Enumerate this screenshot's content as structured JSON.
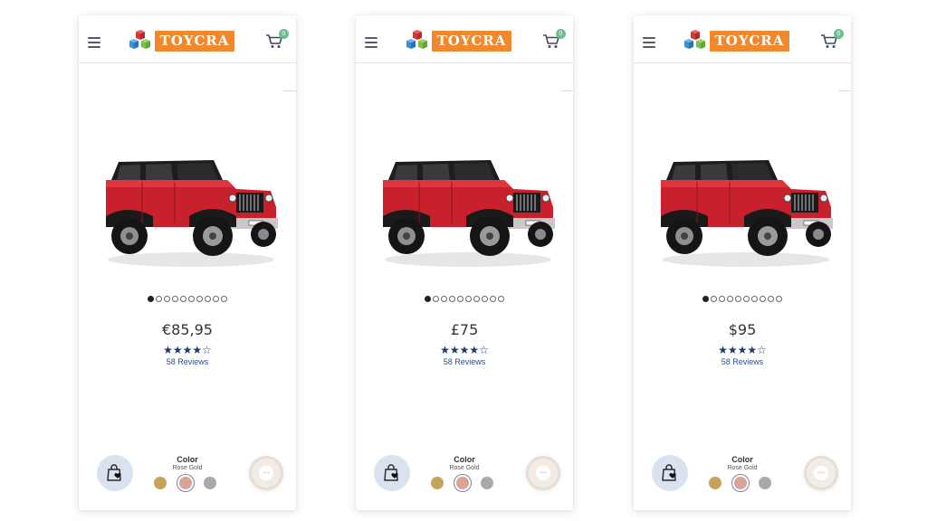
{
  "brand": {
    "logo_text": "TOYCRA",
    "colors": {
      "accent": "#f0892e",
      "star": "#1f3a66",
      "link": "#2c4e8a"
    }
  },
  "icons": {
    "menu": "hamburger-icon",
    "cart": "cart-icon",
    "wishlist": "shopping-bag-heart-icon",
    "fab": "chat-icon"
  },
  "phones": [
    {
      "cart_count": "0",
      "price": "€85,95",
      "rating": 4.5,
      "stars": "★★★★☆",
      "reviews": "58 Reviews",
      "gallery": {
        "total": 10,
        "active": 1
      },
      "color": {
        "label": "Color",
        "value": "Rose Gold",
        "swatches": [
          "#c4a35a",
          "#d9a497",
          "#a9a9a9"
        ],
        "selected": 2
      }
    },
    {
      "cart_count": "0",
      "price": "£75",
      "rating": 4.5,
      "stars": "★★★★☆",
      "reviews": "58 Reviews",
      "gallery": {
        "total": 10,
        "active": 1
      },
      "color": {
        "label": "Color",
        "value": "Rose Gold",
        "swatches": [
          "#c4a35a",
          "#d9a497",
          "#a9a9a9"
        ],
        "selected": 2
      }
    },
    {
      "cart_count": "0",
      "price": "$95",
      "rating": 4.5,
      "stars": "★★★★☆",
      "reviews": "58 Reviews",
      "gallery": {
        "total": 10,
        "active": 1
      },
      "color": {
        "label": "Color",
        "value": "Rose Gold",
        "swatches": [
          "#c4a35a",
          "#d9a497",
          "#a9a9a9"
        ],
        "selected": 2
      }
    }
  ]
}
